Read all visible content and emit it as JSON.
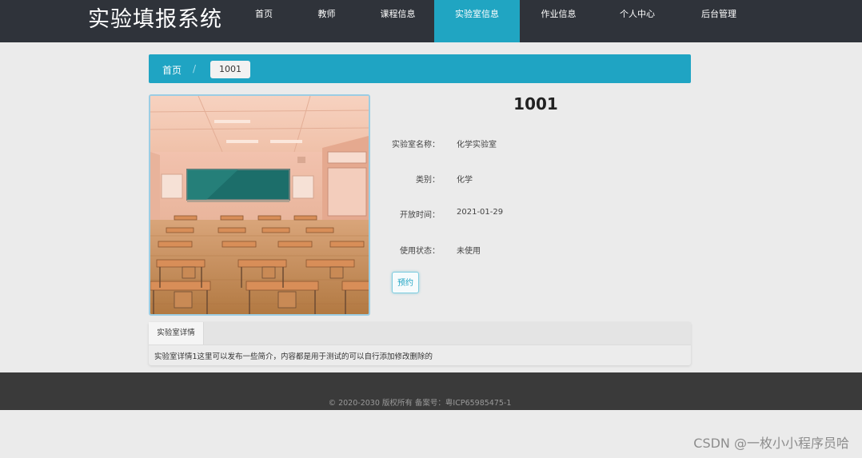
{
  "header": {
    "site_title": "实验填报系统",
    "nav": [
      {
        "label": "首页",
        "active": false
      },
      {
        "label": "教师",
        "active": false
      },
      {
        "label": "课程信息",
        "active": false
      },
      {
        "label": "实验室信息",
        "active": true
      },
      {
        "label": "作业信息",
        "active": false
      },
      {
        "label": "个人中心",
        "active": false
      },
      {
        "label": "后台管理",
        "active": false
      }
    ]
  },
  "breadcrumb": {
    "home": "首页",
    "separator": "/",
    "current": "1001"
  },
  "lab": {
    "image_alt": "classroom-illustration",
    "title": "1001",
    "fields": [
      {
        "label": "实验室名称：",
        "value": "化学实验室"
      },
      {
        "label": "类别：",
        "value": "化学"
      },
      {
        "label": "开放时间：",
        "value": "2021-01-29"
      },
      {
        "label": "使用状态：",
        "value": "未使用"
      }
    ],
    "reserve_label": "预约"
  },
  "tabs": {
    "active_label": "实验室详情",
    "content": "实验室详情1这里可以发布一些简介，内容都是用于测试的可以自行添加修改删除的"
  },
  "footer": {
    "copyright": "© 2020-2030 版权所有 备案号：粤ICP65985475-1"
  },
  "watermark": "CSDN @一枚小小程序员哈",
  "colors": {
    "topbar": "#2f333a",
    "accent": "#1fa4c3",
    "footer": "#3a3a3a"
  }
}
